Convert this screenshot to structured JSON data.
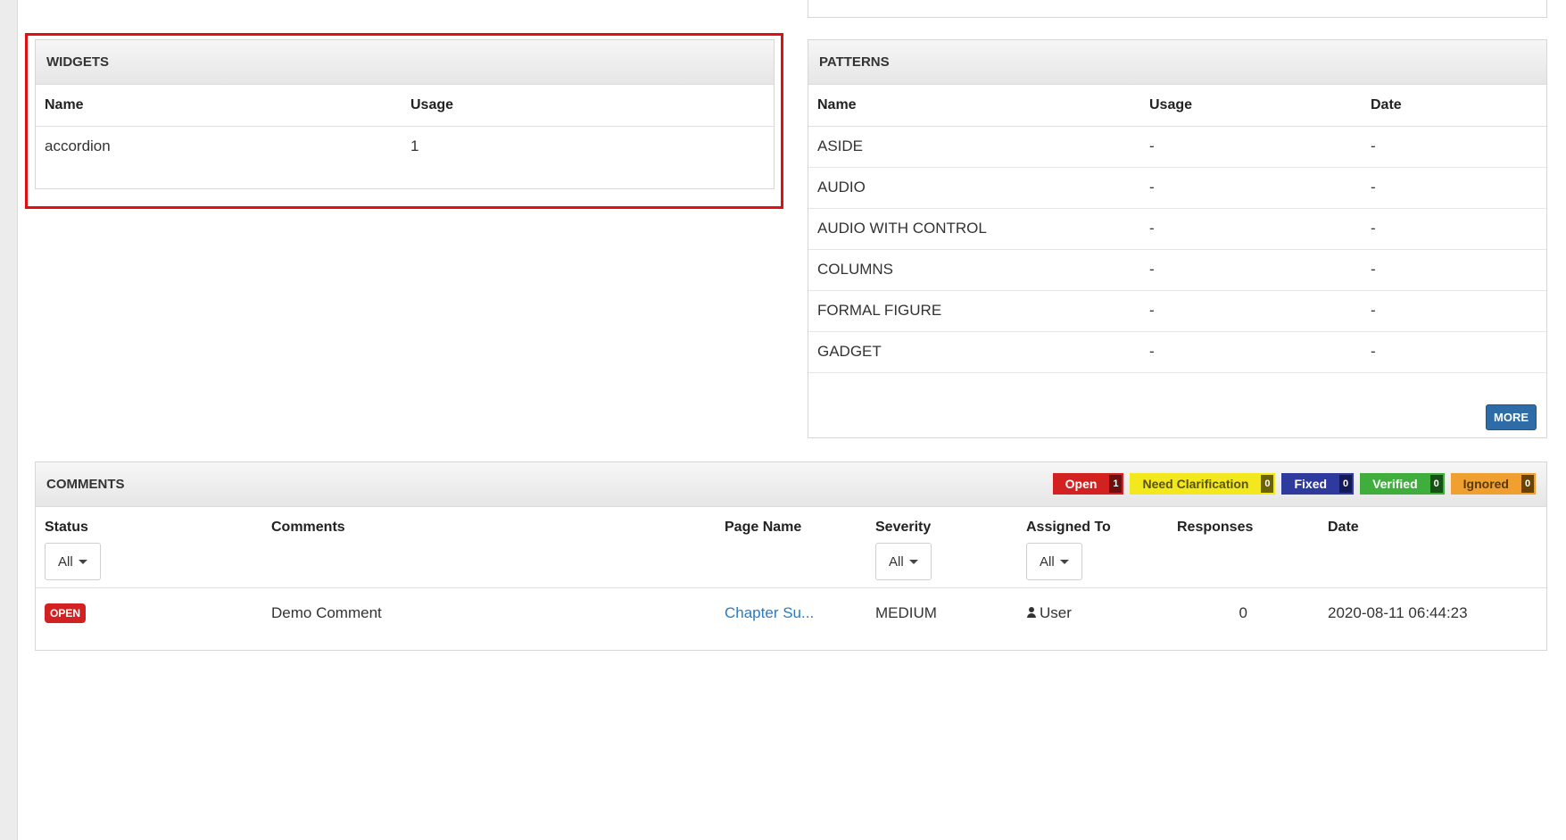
{
  "widgets": {
    "title": "WIDGETS",
    "columns": [
      "Name",
      "Usage"
    ],
    "rows": [
      {
        "name": "accordion",
        "usage": "1"
      }
    ]
  },
  "patterns": {
    "title": "PATTERNS",
    "columns": [
      "Name",
      "Usage",
      "Date"
    ],
    "rows": [
      {
        "name": "ASIDE",
        "usage": "-",
        "date": "-"
      },
      {
        "name": "AUDIO",
        "usage": "-",
        "date": "-"
      },
      {
        "name": "AUDIO WITH CONTROL",
        "usage": "-",
        "date": "-"
      },
      {
        "name": "COLUMNS",
        "usage": "-",
        "date": "-"
      },
      {
        "name": "FORMAL FIGURE",
        "usage": "-",
        "date": "-"
      },
      {
        "name": "GADGET",
        "usage": "-",
        "date": "-"
      }
    ],
    "more_label": "MORE"
  },
  "comments": {
    "title": "COMMENTS",
    "legend": [
      {
        "label": "Open",
        "count": "1",
        "color": "#d32121"
      },
      {
        "label": "Need Clarification",
        "count": "0",
        "color": "#f3e81d"
      },
      {
        "label": "Fixed",
        "count": "0",
        "color": "#2f3a9e"
      },
      {
        "label": "Verified",
        "count": "0",
        "color": "#3fae3c"
      },
      {
        "label": "Ignored",
        "count": "0",
        "color": "#f0a030"
      }
    ],
    "columns": {
      "status": "Status",
      "comments": "Comments",
      "page_name": "Page Name",
      "severity": "Severity",
      "assigned_to": "Assigned To",
      "responses": "Responses",
      "date": "Date"
    },
    "filters": {
      "status": "All",
      "severity": "All",
      "assigned_to": "All"
    },
    "rows": [
      {
        "status": "OPEN",
        "comment": "Demo Comment",
        "page_name": "Chapter Su...",
        "severity": "MEDIUM",
        "assigned_to": "User",
        "responses": "0",
        "date": "2020-08-11 06:44:23"
      }
    ]
  }
}
